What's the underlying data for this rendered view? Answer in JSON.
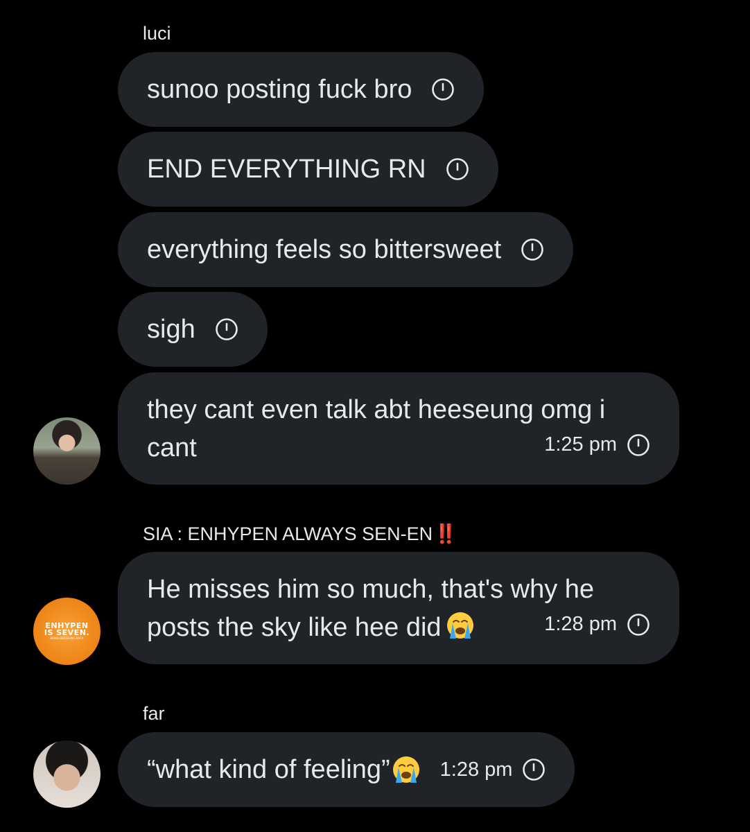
{
  "groups": [
    {
      "sender": "luci",
      "messages": [
        {
          "text": "sunoo posting fuck bro"
        },
        {
          "text": "END EVERYTHING RN"
        },
        {
          "text": "everything feels so bittersweet"
        },
        {
          "text": "sigh"
        },
        {
          "lines": [
            "they cant even talk abt heeseung omg i",
            "cant"
          ],
          "time": "1:25 pm"
        }
      ],
      "avatar": "profile-photo"
    },
    {
      "sender": "SIA : ENHYPEN ALWAYS SEN-EN",
      "sender_glyph": "‼️",
      "messages": [
        {
          "lines": [
            "He misses him so much, that's why he",
            "posts the sky like hee did"
          ],
          "emoji": "loudly-crying-face",
          "time": "1:28 pm"
        }
      ],
      "avatar": "profile-photo",
      "avatar_text": [
        "ENHYPEN",
        "IS SEVEN.",
        "BRING HEESEUNG BACK"
      ]
    },
    {
      "sender": "far",
      "messages": [
        {
          "text": "“what kind of feeling”",
          "emoji": "loudly-crying-face",
          "time": "1:28 pm"
        }
      ],
      "avatar": "profile-photo"
    }
  ],
  "icons": {
    "status": "clock-icon",
    "emoji": "loudly-crying-face-icon"
  },
  "colors": {
    "background": "#000000",
    "bubble": "#202327",
    "text": "#e7e9ea",
    "alert": "#f4212e"
  }
}
